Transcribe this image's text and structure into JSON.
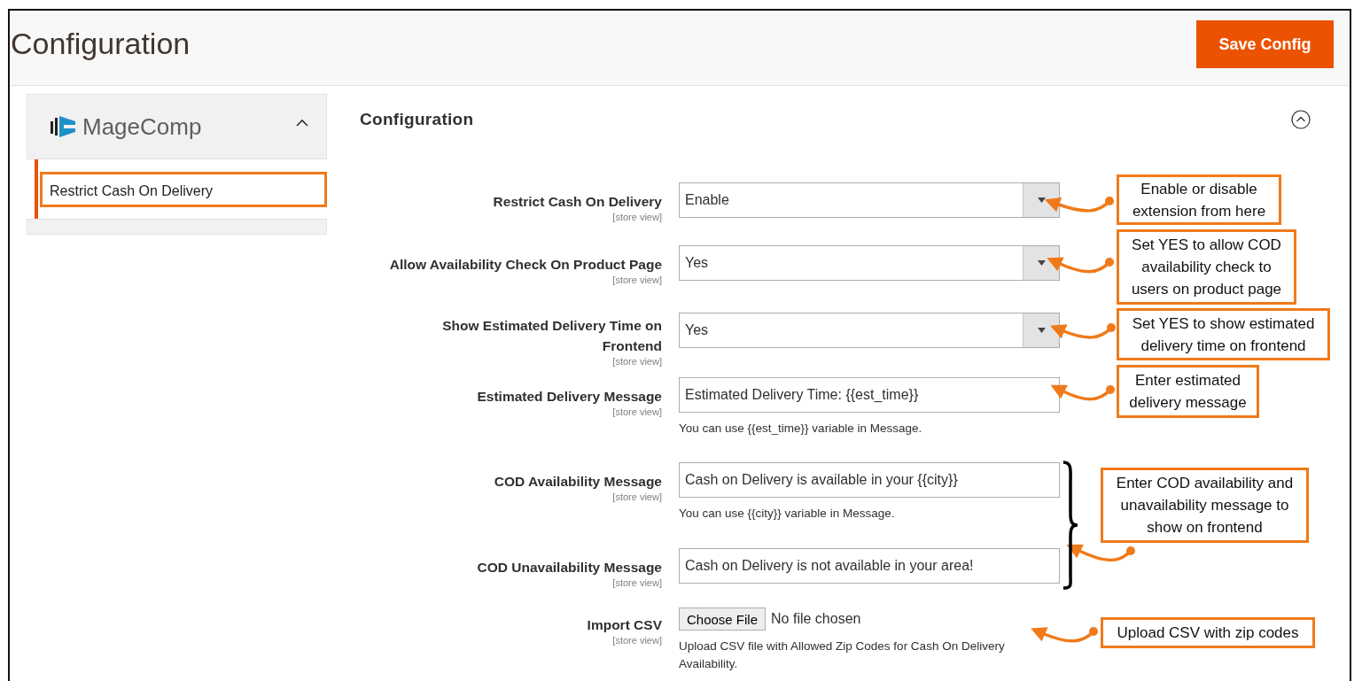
{
  "header": {
    "title": "Configuration",
    "save_button": "Save Config"
  },
  "sidebar": {
    "logo_text": "MageComp",
    "expanded": true,
    "items": [
      {
        "label": "Restrict Cash On Delivery",
        "selected": true
      }
    ]
  },
  "section": {
    "title": "Configuration",
    "expanded": true
  },
  "fields": [
    {
      "kind": "select",
      "label": "Restrict Cash On Delivery",
      "scope": "[store view]",
      "value": "Enable"
    },
    {
      "kind": "select",
      "label": "Allow Availability Check On Product Page",
      "scope": "[store view]",
      "value": "Yes"
    },
    {
      "kind": "select",
      "label": "Show Estimated Delivery Time on Frontend",
      "scope": "[store view]",
      "value": "Yes"
    },
    {
      "kind": "text",
      "label": "Estimated Delivery Message",
      "scope": "[store view]",
      "value": "Estimated Delivery Time: {{est_time}}",
      "note": "You can use {{est_time}} variable in Message."
    },
    {
      "kind": "text",
      "label": "COD Availability Message",
      "scope": "[store view]",
      "value": "Cash on Delivery is available in your {{city}}",
      "note": "You can use {{city}} variable in Message."
    },
    {
      "kind": "text",
      "label": "COD Unavailability Message",
      "scope": "[store view]",
      "value": "Cash on Delivery is not available in your area!"
    },
    {
      "kind": "file",
      "label": "Import CSV",
      "scope": "[store view]",
      "button": "Choose File",
      "status": "No file chosen",
      "note": "Upload CSV file with Allowed Zip Codes for Cash On Delivery Availability."
    }
  ],
  "annotations": [
    {
      "text": "Enable or disable extension from here"
    },
    {
      "text": "Set YES to allow COD availability check to users on product page"
    },
    {
      "text": "Set YES to show estimated delivery time on frontend"
    },
    {
      "text": "Enter estimated delivery message"
    },
    {
      "text": "Enter COD availability and unavailability message to show on frontend"
    },
    {
      "text": "Upload CSV with zip codes"
    }
  ]
}
